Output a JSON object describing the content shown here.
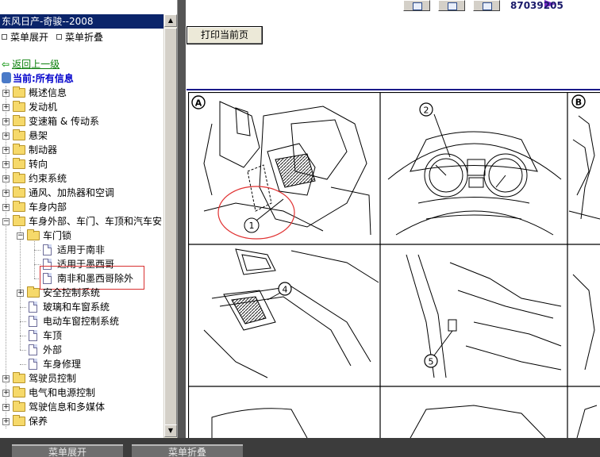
{
  "window_title": "东风日产-奇骏--2008",
  "menu": {
    "expand_label": "菜单展开",
    "collapse_label": "菜单折叠"
  },
  "nav": {
    "back_label": "返回上一级",
    "current_label": "当前:所有信息"
  },
  "tree": {
    "items": [
      {
        "label": "概述信息"
      },
      {
        "label": "发动机"
      },
      {
        "label": "变速箱 & 传动系"
      },
      {
        "label": "悬架"
      },
      {
        "label": "制动器"
      },
      {
        "label": "转向"
      },
      {
        "label": "约束系统"
      },
      {
        "label": "通风、加热器和空调"
      },
      {
        "label": "车身内部"
      },
      {
        "label": "车身外部、车门、车顶和汽车安"
      },
      {
        "label": "车门锁"
      },
      {
        "label": "适用于南非"
      },
      {
        "label": "适用于墨西哥"
      },
      {
        "label": "南非和墨西哥除外"
      },
      {
        "label": "安全控制系统"
      },
      {
        "label": "玻璃和车窗系统"
      },
      {
        "label": "电动车窗控制系统"
      },
      {
        "label": "车顶"
      },
      {
        "label": "外部"
      },
      {
        "label": "车身修理"
      },
      {
        "label": "驾驶员控制"
      },
      {
        "label": "电气和电源控制"
      },
      {
        "label": "驾驶信息和多媒体"
      },
      {
        "label": "保养"
      }
    ]
  },
  "toolbar": {
    "code_id": "87039205"
  },
  "content": {
    "print_label": "打印当前页"
  },
  "diagram": {
    "marker_a": "A",
    "marker_b": "B",
    "callout_1": "1",
    "callout_2": "2",
    "callout_4": "4",
    "callout_5": "5"
  },
  "bottom": {
    "left_label": "菜单展开",
    "right_label": "菜单折叠"
  },
  "colors": {
    "title_bar": "#0a246a",
    "link_green": "#0a7f0a",
    "current_blue": "#0000cc",
    "highlight_red": "#d83030",
    "rule_blue": "#1a1a8a"
  },
  "icons": {
    "back": "back-arrow-icon",
    "current": "pin-icon",
    "folder": "folder-icon",
    "document": "document-icon",
    "expand": "plus-box-icon",
    "collapse": "minus-box-icon"
  }
}
